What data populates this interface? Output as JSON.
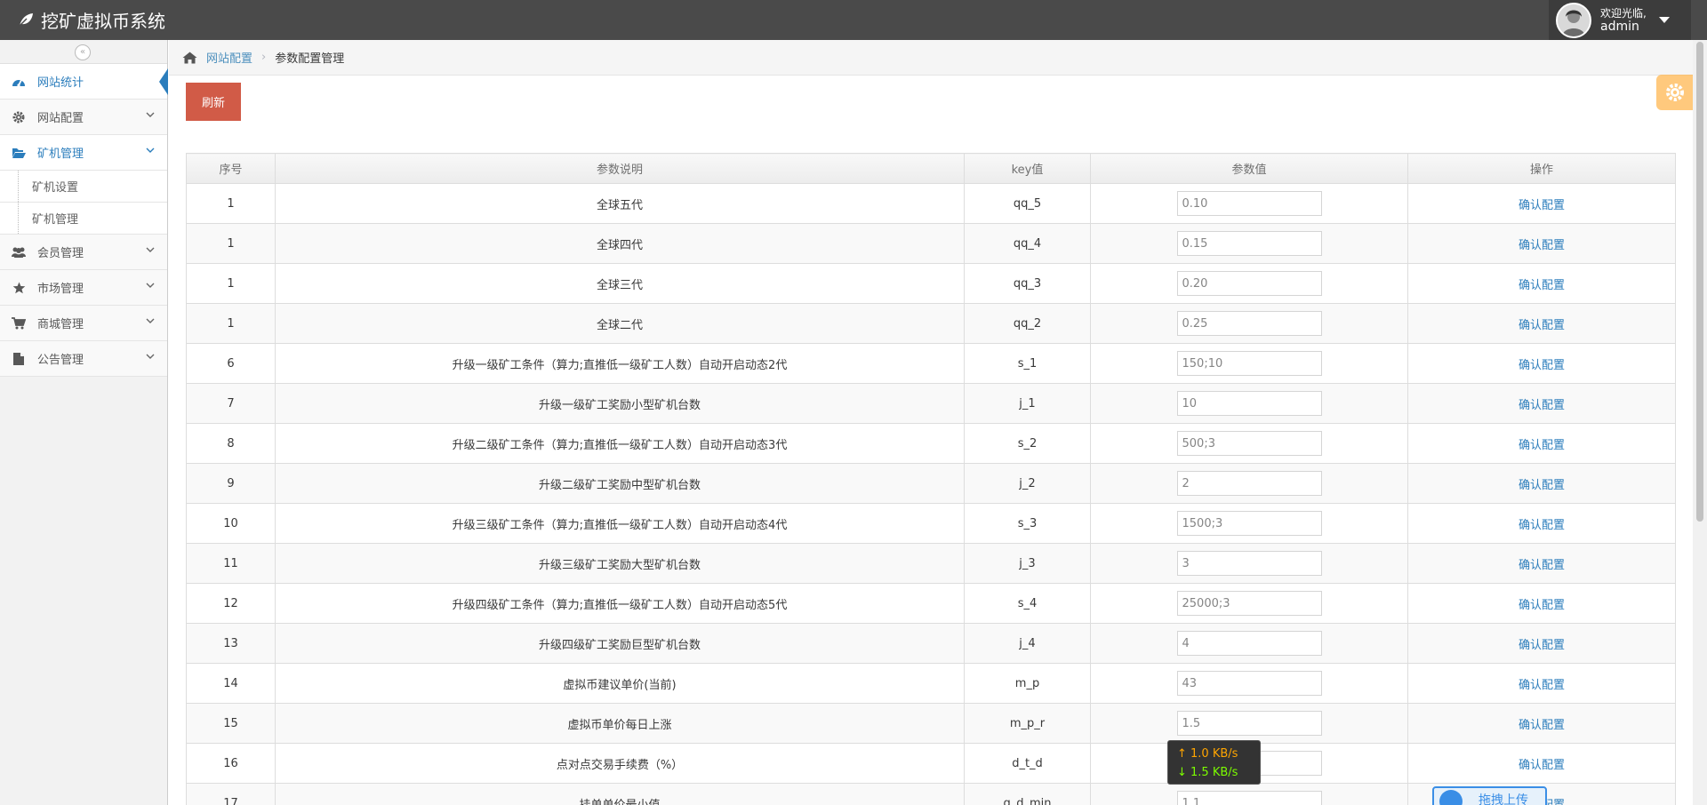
{
  "app": {
    "title": "挖矿虚拟币系统"
  },
  "user": {
    "welcome": "欢迎光临,",
    "name": "admin"
  },
  "sidebar": {
    "collapse_glyph": "«",
    "items": [
      {
        "label": "网站统计",
        "icon": "dashboard-icon"
      },
      {
        "label": "网站配置",
        "icon": "gear-icon"
      },
      {
        "label": "矿机管理",
        "icon": "folder-open-icon"
      },
      {
        "label": "会员管理",
        "icon": "users-icon"
      },
      {
        "label": "市场管理",
        "icon": "star-icon"
      },
      {
        "label": "商城管理",
        "icon": "cart-icon"
      },
      {
        "label": "公告管理",
        "icon": "file-icon"
      }
    ],
    "subitems": [
      {
        "label": "矿机设置"
      },
      {
        "label": "矿机管理"
      }
    ]
  },
  "breadcrumb": {
    "parent": "网站配置",
    "current": "参数配置管理"
  },
  "toolbar": {
    "refresh_label": "刷新"
  },
  "table": {
    "headers": [
      "序号",
      "参数说明",
      "key值",
      "参数值",
      "操作"
    ],
    "action_label": "确认配置",
    "rows": [
      {
        "id": "1",
        "desc": "全球五代",
        "key": "qq_5",
        "value": "0.10"
      },
      {
        "id": "1",
        "desc": "全球四代",
        "key": "qq_4",
        "value": "0.15"
      },
      {
        "id": "1",
        "desc": "全球三代",
        "key": "qq_3",
        "value": "0.20"
      },
      {
        "id": "1",
        "desc": "全球二代",
        "key": "qq_2",
        "value": "0.25"
      },
      {
        "id": "6",
        "desc": "升级一级矿工条件（算力;直推低一级矿工人数）自动开启动态2代",
        "key": "s_1",
        "value": "150;10"
      },
      {
        "id": "7",
        "desc": "升级一级矿工奖励小型矿机台数",
        "key": "j_1",
        "value": "10"
      },
      {
        "id": "8",
        "desc": "升级二级矿工条件（算力;直推低一级矿工人数）自动开启动态3代",
        "key": "s_2",
        "value": "500;3"
      },
      {
        "id": "9",
        "desc": "升级二级矿工奖励中型矿机台数",
        "key": "j_2",
        "value": "2"
      },
      {
        "id": "10",
        "desc": "升级三级矿工条件（算力;直推低一级矿工人数）自动开启动态4代",
        "key": "s_3",
        "value": "1500;3"
      },
      {
        "id": "11",
        "desc": "升级三级矿工奖励大型矿机台数",
        "key": "j_3",
        "value": "3"
      },
      {
        "id": "12",
        "desc": "升级四级矿工条件（算力;直推低一级矿工人数）自动开启动态5代",
        "key": "s_4",
        "value": "25000;3"
      },
      {
        "id": "13",
        "desc": "升级四级矿工奖励巨型矿机台数",
        "key": "j_4",
        "value": "4"
      },
      {
        "id": "14",
        "desc": "虚拟币建议单价(当前)",
        "key": "m_p",
        "value": "43"
      },
      {
        "id": "15",
        "desc": "虚拟币单价每日上涨",
        "key": "m_p_r",
        "value": "1.5"
      },
      {
        "id": "16",
        "desc": "点对点交易手续费（%）",
        "key": "d_t_d",
        "value": ""
      },
      {
        "id": "17",
        "desc": "挂单单价最小值",
        "key": "g_d_min",
        "value": "1.1"
      }
    ]
  },
  "netspeed": {
    "up": "↑ 1.0 KB/s",
    "down": "↓ 1.5 KB/s"
  },
  "upload_widget": {
    "label": "拖拽上传"
  },
  "colors": {
    "navbar": "#4a4a4a",
    "accent": "#2b7dbc",
    "danger": "#d15b47",
    "warning": "#ffb752"
  }
}
